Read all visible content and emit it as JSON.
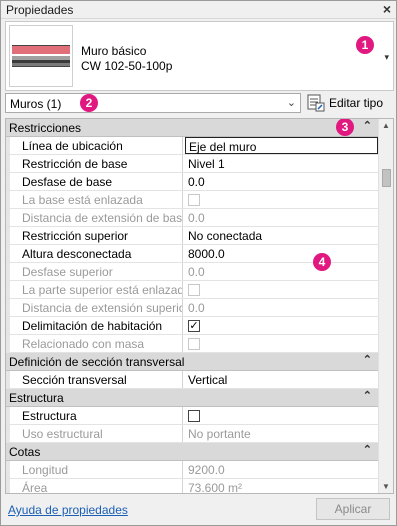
{
  "window": {
    "title": "Propiedades",
    "close_icon": "×"
  },
  "type_selector": {
    "family": "Muro básico",
    "type": "CW 102-50-100p",
    "dropdown_icon": "▾"
  },
  "filter": {
    "value": "Muros (1)",
    "chevron": "⌄",
    "edit_type_label": "Editar tipo"
  },
  "badges": [
    "1",
    "2",
    "3",
    "4"
  ],
  "sections": [
    {
      "title": "Restricciones",
      "collapse_icon": "⌃",
      "rows": [
        {
          "label": "Línea de ubicación",
          "value": "Eje del muro"
        },
        {
          "label": "Restricción de base",
          "value": "Nivel 1"
        },
        {
          "label": "Desfase de base",
          "value": "0.0"
        },
        {
          "label": "La base está enlazada",
          "value": ""
        },
        {
          "label": "Distancia de extensión de base",
          "value": "0.0"
        },
        {
          "label": "Restricción superior",
          "value": "No conectada"
        },
        {
          "label": "Altura desconectada",
          "value": "8000.0"
        },
        {
          "label": "Desfase superior",
          "value": "0.0"
        },
        {
          "label": "La parte superior está enlazada",
          "value": ""
        },
        {
          "label": "Distancia de extensión superior",
          "value": "0.0"
        },
        {
          "label": "Delimitación de habitación",
          "value": "✓"
        },
        {
          "label": "Relacionado con masa",
          "value": ""
        }
      ]
    },
    {
      "title": "Definición de sección transversal",
      "collapse_icon": "⌃",
      "rows": [
        {
          "label": "Sección transversal",
          "value": "Vertical"
        }
      ]
    },
    {
      "title": "Estructura",
      "collapse_icon": "⌃",
      "rows": [
        {
          "label": "Estructura",
          "value": ""
        },
        {
          "label": "Uso estructural",
          "value": "No portante"
        }
      ]
    },
    {
      "title": "Cotas",
      "collapse_icon": "⌃",
      "rows": [
        {
          "label": "Longitud",
          "value": "9200.0"
        },
        {
          "label": "Área",
          "value": "73.600 m²"
        }
      ]
    }
  ],
  "footer": {
    "help_link": "Ayuda de propiedades",
    "apply_label": "Aplicar"
  },
  "colors": {
    "badge": "#e0187f",
    "link": "#1a5fb4",
    "section_bg": "#d9d9d9"
  }
}
